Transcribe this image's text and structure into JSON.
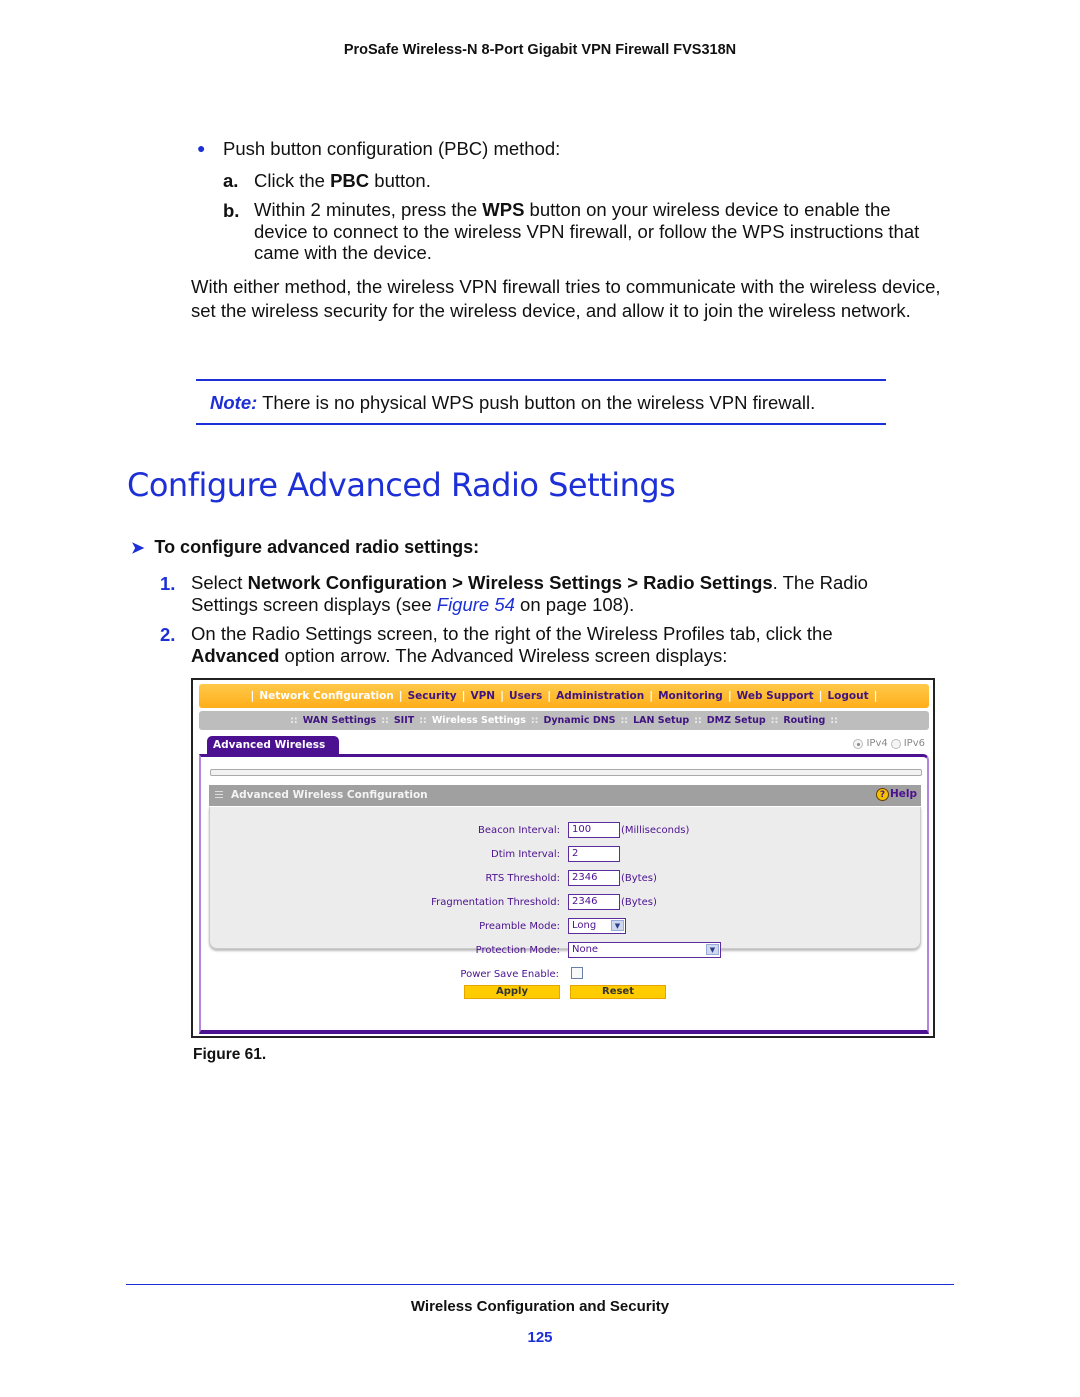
{
  "header": {
    "title": "ProSafe Wireless-N 8-Port Gigabit VPN Firewall FVS318N"
  },
  "pbc": {
    "bullet": "Push button configuration (PBC) method:",
    "steps": [
      {
        "label": "a.",
        "pre": "Click the ",
        "bold": "PBC",
        "post": " button."
      },
      {
        "label": "b.",
        "pre": "Within 2 minutes, press the ",
        "bold": "WPS",
        "post": " button on your wireless device to enable the device to connect to the wireless VPN firewall, or follow the WPS instructions that came with the device."
      }
    ]
  },
  "paragraph": "With either method, the wireless VPN firewall tries to communicate with the wireless device, set the wireless security for the wireless device, and allow it to join the wireless network.",
  "note": {
    "label": "Note:",
    "text": " There is no physical WPS push button on the wireless VPN firewall."
  },
  "section_title": "Configure Advanced Radio Settings",
  "procedure": {
    "heading": "To configure advanced radio settings:",
    "steps": [
      {
        "num": "1.",
        "t1": "Select ",
        "b1": "Network Configuration > Wireless Settings > Radio Settings",
        "t2": ". The Radio Settings screen displays (see ",
        "link": "Figure 54",
        "t3": " on page 108)."
      },
      {
        "num": "2.",
        "t1": "On the Radio Settings screen, to the right of the Wireless Profiles tab, click the ",
        "b1": "Advanced",
        "t2": " option arrow. The Advanced Wireless screen displays:"
      }
    ]
  },
  "screenshot": {
    "main_nav": [
      "Network Configuration",
      "Security",
      "VPN",
      "Users",
      "Administration",
      "Monitoring",
      "Web Support",
      "Logout"
    ],
    "main_nav_active": "Network Configuration",
    "sub_nav": [
      "WAN Settings",
      "SIIT",
      "Wireless Settings",
      "Dynamic DNS",
      "LAN Setup",
      "DMZ Setup",
      "Routing"
    ],
    "sub_nav_active": "Wireless Settings",
    "tab": "Advanced Wireless",
    "ip_options": [
      "IPv4",
      "IPv6"
    ],
    "ip_selected": "IPv4",
    "section_header": "Advanced Wireless Configuration",
    "help_label": "Help",
    "fields": {
      "beacon": {
        "label": "Beacon Interval:",
        "value": "100",
        "unit": "(Milliseconds)"
      },
      "dtim": {
        "label": "Dtim Interval:",
        "value": "2"
      },
      "rts": {
        "label": "RTS Threshold:",
        "value": "2346",
        "unit": "(Bytes)"
      },
      "frag": {
        "label": "Fragmentation Threshold:",
        "value": "2346",
        "unit": "(Bytes)"
      },
      "preamble": {
        "label": "Preamble Mode:",
        "value": "Long"
      },
      "protection": {
        "label": "Protection Mode:",
        "value": "None"
      },
      "powersave": {
        "label": "Power Save Enable:",
        "checked": false
      }
    },
    "apply_label": "Apply",
    "reset_label": "Reset"
  },
  "figure_caption": "Figure 61.",
  "footer": {
    "title": "Wireless Configuration and Security",
    "page": "125"
  }
}
